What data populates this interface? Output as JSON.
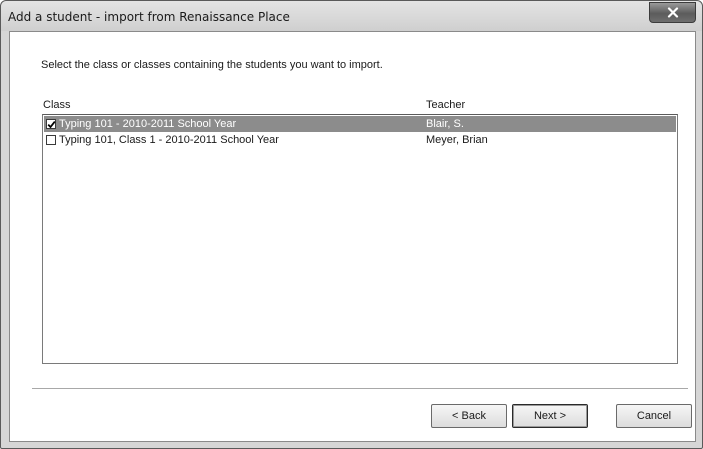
{
  "window": {
    "title": "Add a student - import from Renaissance Place",
    "close_icon": "close-icon"
  },
  "instruction": "Select the class or classes containing the students you want to import.",
  "list": {
    "columns": {
      "class": "Class",
      "teacher": "Teacher"
    },
    "rows": [
      {
        "class": "Typing 101 - 2010-2011 School Year",
        "teacher": "Blair, S.",
        "checked": true,
        "selected": true
      },
      {
        "class": "Typing 101, Class 1 - 2010-2011 School Year",
        "teacher": "Meyer, Brian",
        "checked": false,
        "selected": false
      }
    ]
  },
  "buttons": {
    "back": "< Back",
    "next": "Next >",
    "cancel": "Cancel"
  },
  "colors": {
    "selection": "#8c8c8c",
    "dialog_background": "#ffffff",
    "frame": "#d6d6d6"
  }
}
